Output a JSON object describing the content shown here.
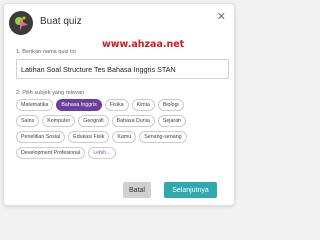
{
  "dialog": {
    "title": "Buat quiz",
    "watermark": "www.ahzaa.net",
    "colors": {
      "accent": "#6b3fa0",
      "primary_button": "#2fa8b0",
      "watermark": "#d11c1c"
    }
  },
  "quiz_name": {
    "label": "1. Berikan nama quiz ini",
    "value": "Latihan Soal Structure Tes Bahasa Inggris STAN"
  },
  "subjects": {
    "label": "2. Pilih subjek yang relevan",
    "rows": [
      [
        {
          "label": "Matematika",
          "selected": false
        },
        {
          "label": "Bahasa Inggris",
          "selected": true
        },
        {
          "label": "Fisika",
          "selected": false
        },
        {
          "label": "Kimia",
          "selected": false
        },
        {
          "label": "Biologi",
          "selected": false
        }
      ],
      [
        {
          "label": "Sains",
          "selected": false
        },
        {
          "label": "Komputer",
          "selected": false
        },
        {
          "label": "Geografi",
          "selected": false
        },
        {
          "label": "Bahasa Dunia",
          "selected": false
        },
        {
          "label": "Sejarah",
          "selected": false
        }
      ],
      [
        {
          "label": "Penelitian Sosial",
          "selected": false
        },
        {
          "label": "Edukasi Fisik",
          "selected": false
        },
        {
          "label": "Kamu",
          "selected": false
        },
        {
          "label": "Senang-senang",
          "selected": false
        }
      ],
      [
        {
          "label": "Development Profesional",
          "selected": false
        },
        {
          "label": "Lebih...",
          "selected": false
        }
      ]
    ]
  },
  "footer": {
    "cancel_label": "Batal",
    "next_label": "Selanjutnya"
  },
  "icons": {
    "header": "quiz-logo-icon",
    "close": "close-icon"
  }
}
